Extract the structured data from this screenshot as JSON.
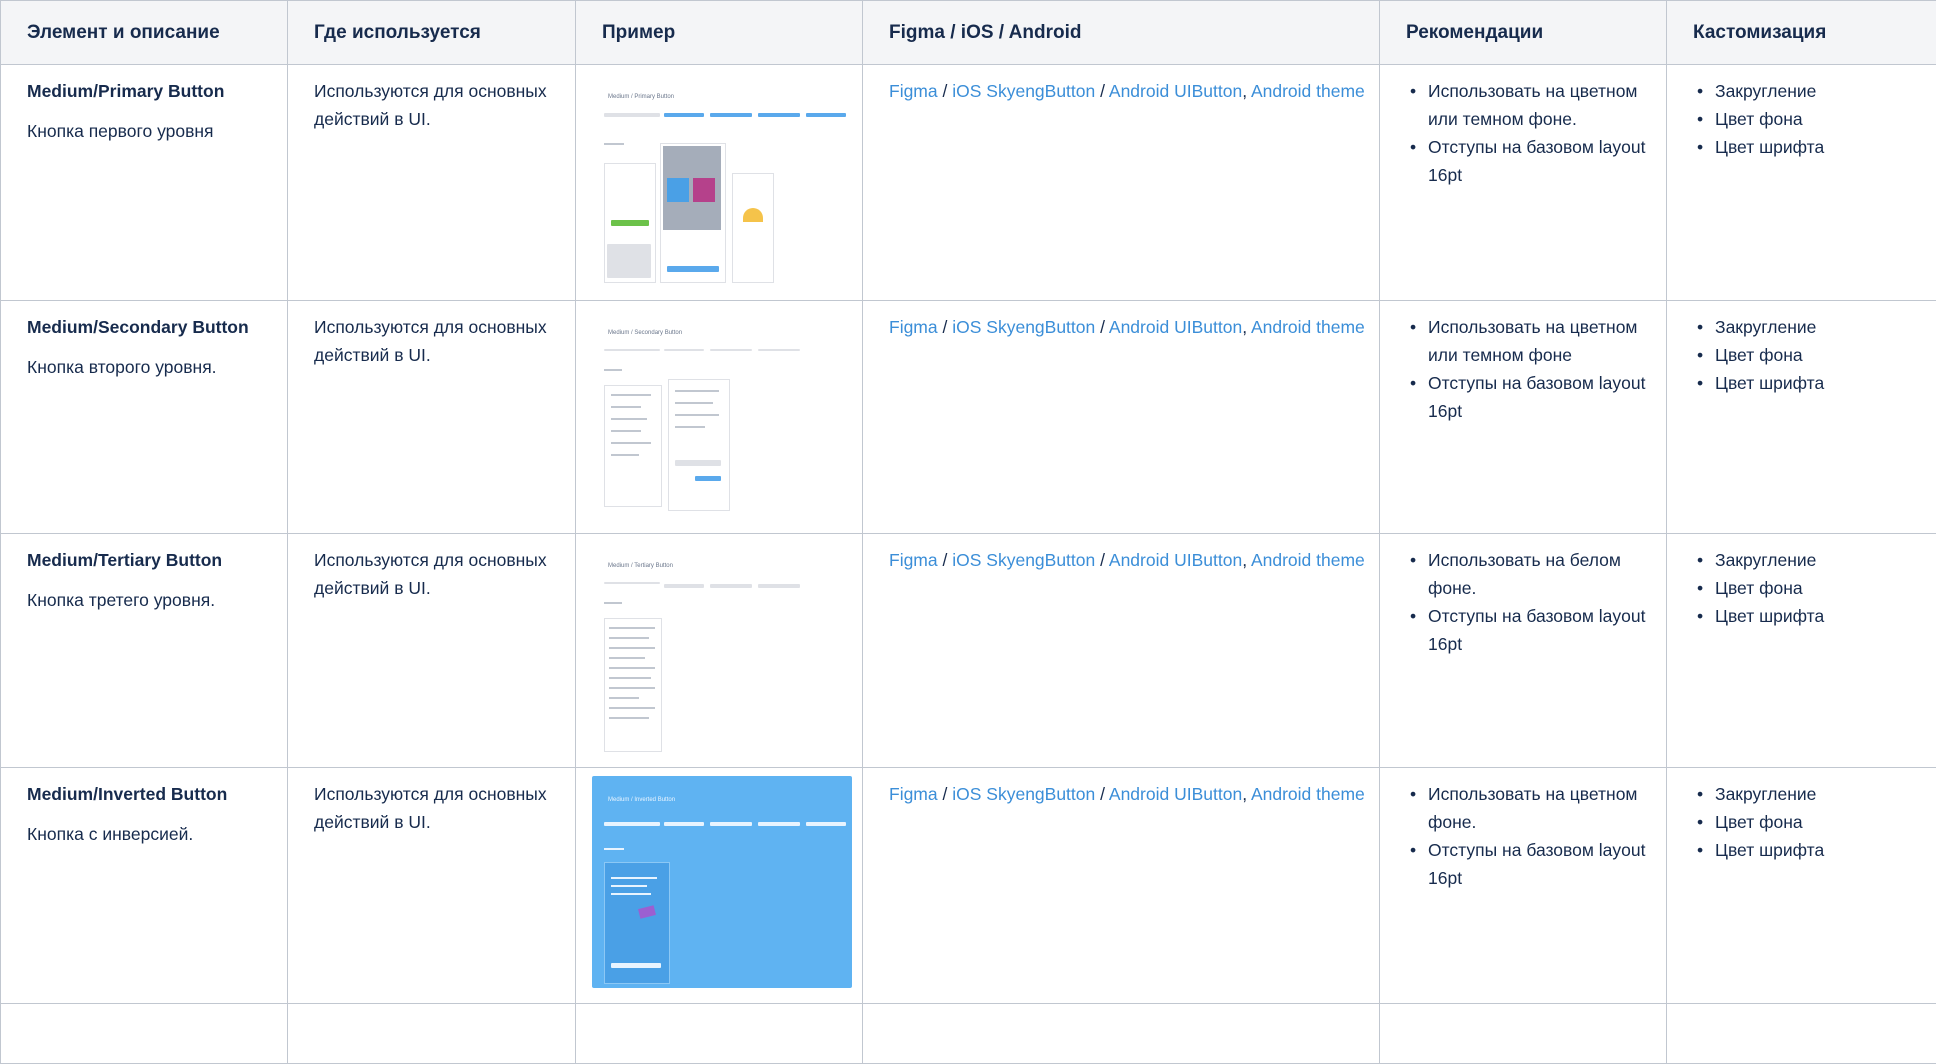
{
  "header": {
    "col_element": "Элемент и описание",
    "col_where": "Где используется",
    "col_example": "Пример",
    "col_platforms": "Figma / iOS / Android",
    "col_recommendations": "Рекомендации",
    "col_customization": "Кастомизация"
  },
  "rows": [
    {
      "name": "Medium/Primary Button",
      "description": "Кнопка первого уровня",
      "where": "Используются для основных действий в UI.",
      "thumb_title": "Medium / Primary Button",
      "links": {
        "figma": "Figma",
        "ios": "iOS SkyengButton",
        "android": "Android UIButton",
        "android_theme": "Android theme",
        "sep": "/",
        "comma": ","
      },
      "recommendations": [
        "Использовать на цветном или темном фоне.",
        "Отступы на базовом layout 16pt"
      ],
      "customization": [
        "Закругление",
        "Цвет фона",
        "Цвет шрифта"
      ]
    },
    {
      "name": "Medium/Secondary Button",
      "description": "Кнопка второго уровня.",
      "where": "Используются для основных действий в UI.",
      "thumb_title": "Medium / Secondary Button",
      "links": {
        "figma": "Figma",
        "ios": "iOS SkyengButton",
        "android": "Android UIButton",
        "android_theme": "Android theme",
        "sep": "/",
        "comma": ","
      },
      "recommendations": [
        "Использовать на цветном или темном фоне",
        "Отступы на базовом layout 16pt"
      ],
      "customization": [
        "Закругление",
        "Цвет фона",
        "Цвет шрифта"
      ]
    },
    {
      "name": "Medium/Tertiary Button",
      "description": "Кнопка третего уровня.",
      "where": "Используются для основных действий в UI.",
      "thumb_title": "Medium / Tertiary Button",
      "links": {
        "figma": "Figma",
        "ios": "iOS SkyengButton",
        "android": "Android UIButton",
        "android_theme": "Android theme",
        "sep": "/",
        "comma": ","
      },
      "recommendations": [
        "Использовать на белом фоне.",
        "Отступы на базовом layout 16pt"
      ],
      "customization": [
        "Закругление",
        "Цвет фона",
        "Цвет шрифта"
      ]
    },
    {
      "name": "Medium/Inverted Button",
      "description": "Кнопка с инверсией.",
      "where": "Используются для основных действий в UI.",
      "thumb_title": "Medium / Inverted Button",
      "links": {
        "figma": "Figma",
        "ios": "iOS SkyengButton",
        "android": "Android UIButton",
        "android_theme": "Android theme",
        "sep": "/",
        "comma": ","
      },
      "recommendations": [
        "Использовать на цветном фоне.",
        "Отступы на базовом layout 16pt"
      ],
      "customization": [
        "Закругление",
        "Цвет фона",
        "Цвет шрифта"
      ]
    }
  ],
  "colors": {
    "link": "#3b8ed8",
    "header_bg": "#f4f5f7",
    "border": "#c1c7d0",
    "inverted_thumb_bg": "#5fb3f2"
  }
}
